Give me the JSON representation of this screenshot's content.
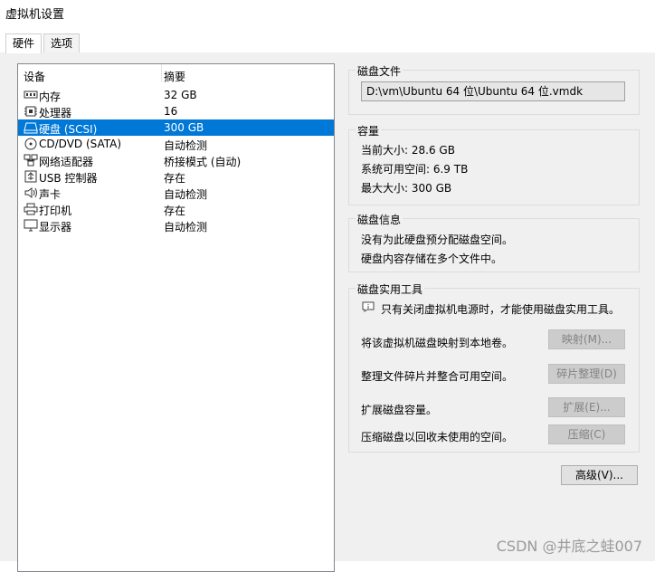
{
  "window": {
    "title": "虚拟机设置"
  },
  "tabs": [
    {
      "label": "硬件"
    },
    {
      "label": "选项"
    }
  ],
  "device_list": {
    "headers": {
      "device": "设备",
      "summary": "摘要"
    },
    "rows": [
      {
        "name": "内存",
        "summary": "32 GB",
        "icon": "memory-icon"
      },
      {
        "name": "处理器",
        "summary": "16",
        "icon": "processor-icon"
      },
      {
        "name": "硬盘 (SCSI)",
        "summary": "300 GB",
        "icon": "harddisk-icon",
        "selected": true
      },
      {
        "name": "CD/DVD (SATA)",
        "summary": "自动检测",
        "icon": "cdrom-icon"
      },
      {
        "name": "网络适配器",
        "summary": "桥接模式 (自动)",
        "icon": "network-icon"
      },
      {
        "name": "USB 控制器",
        "summary": "存在",
        "icon": "usb-icon"
      },
      {
        "name": "声卡",
        "summary": "自动检测",
        "icon": "speaker-icon"
      },
      {
        "name": "打印机",
        "summary": "存在",
        "icon": "printer-icon"
      },
      {
        "name": "显示器",
        "summary": "自动检测",
        "icon": "monitor-icon"
      }
    ]
  },
  "disk_file": {
    "title": "磁盘文件",
    "path": "D:\\vm\\Ubuntu 64 位\\Ubuntu 64 位.vmdk"
  },
  "capacity": {
    "title": "容量",
    "current": "当前大小: 28.6 GB",
    "available": "系统可用空间: 6.9 TB",
    "max": "最大大小: 300 GB"
  },
  "disk_info": {
    "title": "磁盘信息",
    "line1": "没有为此硬盘预分配磁盘空间。",
    "line2": "硬盘内容存储在多个文件中。"
  },
  "disk_tools": {
    "title": "磁盘实用工具",
    "note": "只有关闭虚拟机电源时，才能使用磁盘实用工具。",
    "map_desc": "将该虚拟机磁盘映射到本地卷。",
    "map_btn": "映射(M)...",
    "defrag_desc": "整理文件碎片并整合可用空间。",
    "defrag_btn": "碎片整理(D)",
    "expand_desc": "扩展磁盘容量。",
    "expand_btn": "扩展(E)...",
    "compact_desc": "压缩磁盘以回收未使用的空间。",
    "compact_btn": "压缩(C)"
  },
  "advanced_btn": "高级(V)...",
  "watermark": "CSDN @井底之蛙007"
}
